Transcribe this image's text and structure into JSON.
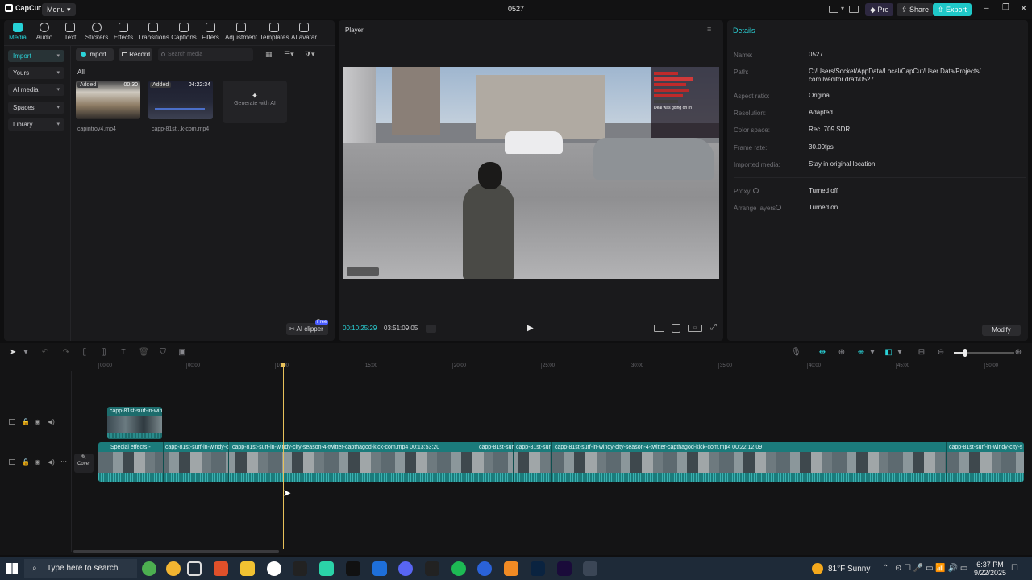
{
  "app": {
    "name": "CapCut",
    "menu_label": "Menu",
    "project_title": "0527",
    "pro_label": "Pro",
    "share_label": "Share",
    "export_label": "Export"
  },
  "toolbar_tabs": [
    {
      "label": "Media"
    },
    {
      "label": "Audio"
    },
    {
      "label": "Text"
    },
    {
      "label": "Stickers"
    },
    {
      "label": "Effects"
    },
    {
      "label": "Transitions"
    },
    {
      "label": "Captions"
    },
    {
      "label": "Filters"
    },
    {
      "label": "Adjustment"
    },
    {
      "label": "Templates"
    },
    {
      "label": "AI avatar"
    }
  ],
  "sidebar": {
    "items": [
      {
        "label": "Import"
      },
      {
        "label": "Yours"
      },
      {
        "label": "AI media"
      },
      {
        "label": "Spaces"
      },
      {
        "label": "Library"
      }
    ]
  },
  "media_panel": {
    "import_btn": "Import",
    "record_btn": "Record",
    "search_placeholder": "Search media",
    "filter_label": "All",
    "cards": [
      {
        "badge": "Added",
        "duration": "00:30",
        "name": "capintrov4.mp4"
      },
      {
        "badge": "Added",
        "duration": "04:22:34",
        "name": "capp-81st...k-com.mp4"
      }
    ],
    "generate_label": "Generate with AI",
    "ai_clipper_label": "AI clipper",
    "ai_clipper_badge": "Free"
  },
  "player": {
    "title": "Player",
    "current_time": "00:10:25:29",
    "total_time": "03:51:09:05",
    "chat_overlay": "Deal was going on rn"
  },
  "details": {
    "title": "Details",
    "rows": [
      {
        "label": "Name:",
        "value": "0527"
      },
      {
        "label": "Path:",
        "value": "C:/Users/Socket/AppData/Local/CapCut/User Data/Projects/",
        "value2": "com.lveditor.draft/0527"
      },
      {
        "label": "Aspect ratio:",
        "value": "Original"
      },
      {
        "label": "Resolution:",
        "value": "Adapted"
      },
      {
        "label": "Color space:",
        "value": "Rec. 709 SDR"
      },
      {
        "label": "Frame rate:",
        "value": "30.00fps"
      },
      {
        "label": "Imported media:",
        "value": "Stay in original location"
      },
      {
        "label": "Proxy:",
        "value": "Turned off"
      },
      {
        "label": "Arrange layers",
        "value": "Turned on"
      }
    ],
    "modify_btn": "Modify"
  },
  "timeline": {
    "ruler": [
      "00:00",
      "00:00",
      "10:00",
      "15:00",
      "20:00",
      "25:00",
      "30:00",
      "35:00",
      "40:00",
      "45:00",
      "50:00"
    ],
    "overlay_clip": "capp-81st-surf-in-win",
    "cover_label": "Cover",
    "main_clips": [
      "Special effects -",
      "capp-81st-surf-in-windy-c",
      "capp-81st-surf-in-windy-city-season-4-twitter-capthagod-kick-com.mp4  00:13:53:20",
      "capp-81st-sur",
      "capp-81st-sur",
      "capp-81st-surf-in-windy-city-season-4-twitter-capthagod-kick-com.mp4  00:22:12:09",
      "capp-81st-surf-in-windy-city-s"
    ]
  },
  "taskbar": {
    "search_placeholder": "Type here to search",
    "weather": "81°F  Sunny",
    "time": "6:37 PM",
    "date": "9/22/2025"
  }
}
